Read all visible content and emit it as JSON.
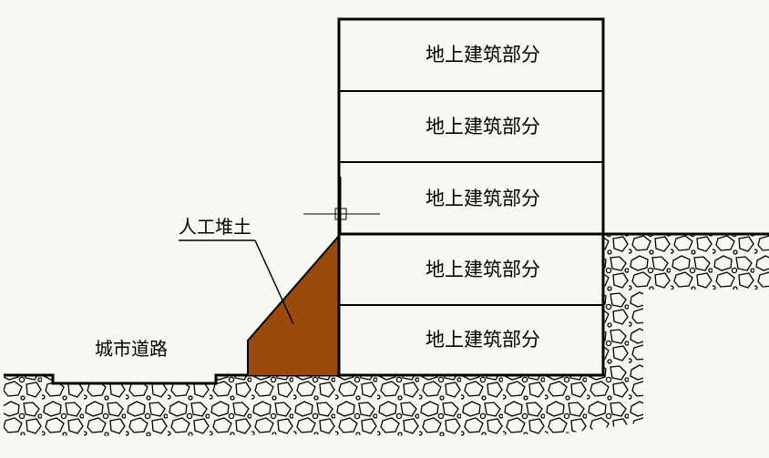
{
  "floors": [
    {
      "label": "地上建筑部分"
    },
    {
      "label": "地上建筑部分"
    },
    {
      "label": "地上建筑部分"
    },
    {
      "label": "地上建筑部分"
    },
    {
      "label": "地上建筑部分"
    }
  ],
  "labels": {
    "fill": "人工堆土",
    "road": "城市道路"
  },
  "colors": {
    "fill_soil": "#9b4a0e",
    "line": "#000000",
    "background": "#f8f8f2"
  }
}
